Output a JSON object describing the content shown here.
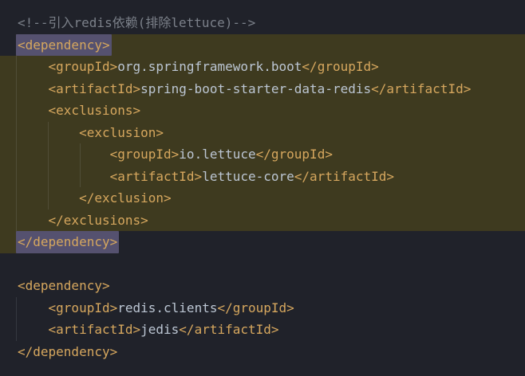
{
  "colors": {
    "background": "#20222a",
    "block": "#3e3a1f",
    "matched_tag": "#55516f",
    "tag": "#d6a75e",
    "text": "#bcc6d3",
    "comment": "#7b8089",
    "guide": "rgba(200,205,215,0.13)"
  },
  "editor": {
    "language": "xml",
    "lines": [
      {
        "indent": 0,
        "guides": [],
        "background": "none",
        "tokens": [
          {
            "type": "comment",
            "text": "<!--引入redis依赖(排除lettuce)-->"
          }
        ]
      },
      {
        "indent": 0,
        "guides": [],
        "background": "from-text",
        "tokens": [
          {
            "type": "tag",
            "text": "<dependency>",
            "matched": true
          }
        ]
      },
      {
        "indent": 1,
        "guides": [
          20
        ],
        "background": "full",
        "tokens": [
          {
            "type": "tag",
            "text": "<groupId>"
          },
          {
            "type": "text",
            "text": "org.springframework.boot"
          },
          {
            "type": "tag",
            "text": "</groupId>"
          }
        ]
      },
      {
        "indent": 1,
        "guides": [
          20
        ],
        "background": "full",
        "tokens": [
          {
            "type": "tag",
            "text": "<artifactId>"
          },
          {
            "type": "text",
            "text": "spring-boot-starter-data-redis"
          },
          {
            "type": "tag",
            "text": "</artifactId>"
          }
        ]
      },
      {
        "indent": 1,
        "guides": [
          20
        ],
        "background": "full",
        "tokens": [
          {
            "type": "tag",
            "text": "<exclusions>"
          }
        ]
      },
      {
        "indent": 2,
        "guides": [
          20,
          60
        ],
        "background": "full",
        "tokens": [
          {
            "type": "tag",
            "text": "<exclusion>"
          }
        ]
      },
      {
        "indent": 3,
        "guides": [
          20,
          60,
          100
        ],
        "background": "full",
        "tokens": [
          {
            "type": "tag",
            "text": "<groupId>"
          },
          {
            "type": "text",
            "text": "io.lettuce"
          },
          {
            "type": "tag",
            "text": "</groupId>"
          }
        ]
      },
      {
        "indent": 3,
        "guides": [
          20,
          60,
          100
        ],
        "background": "full",
        "tokens": [
          {
            "type": "tag",
            "text": "<artifactId>"
          },
          {
            "type": "text",
            "text": "lettuce-core"
          },
          {
            "type": "tag",
            "text": "</artifactId>"
          }
        ]
      },
      {
        "indent": 2,
        "guides": [
          20,
          60
        ],
        "background": "full",
        "tokens": [
          {
            "type": "tag",
            "text": "</exclusion>"
          }
        ]
      },
      {
        "indent": 1,
        "guides": [
          20
        ],
        "background": "full",
        "tokens": [
          {
            "type": "tag",
            "text": "</exclusions>"
          }
        ]
      },
      {
        "indent": 0,
        "guides": [],
        "background": "left-stub",
        "tokens": [
          {
            "type": "tag",
            "text": "</dependency>",
            "matched": true
          }
        ]
      },
      {
        "indent": 0,
        "guides": [],
        "background": "none",
        "tokens": []
      },
      {
        "indent": 0,
        "guides": [],
        "background": "none",
        "tokens": [
          {
            "type": "tag",
            "text": "<dependency>"
          }
        ]
      },
      {
        "indent": 1,
        "guides": [
          20
        ],
        "background": "none",
        "tokens": [
          {
            "type": "tag",
            "text": "<groupId>"
          },
          {
            "type": "text",
            "text": "redis.clients"
          },
          {
            "type": "tag",
            "text": "</groupId>"
          }
        ]
      },
      {
        "indent": 1,
        "guides": [
          20
        ],
        "background": "none",
        "tokens": [
          {
            "type": "tag",
            "text": "<artifactId>"
          },
          {
            "type": "text",
            "text": "jedis"
          },
          {
            "type": "tag",
            "text": "</artifactId>"
          }
        ]
      },
      {
        "indent": 0,
        "guides": [],
        "background": "none",
        "tokens": [
          {
            "type": "tag",
            "text": "</dependency>"
          }
        ]
      }
    ]
  }
}
